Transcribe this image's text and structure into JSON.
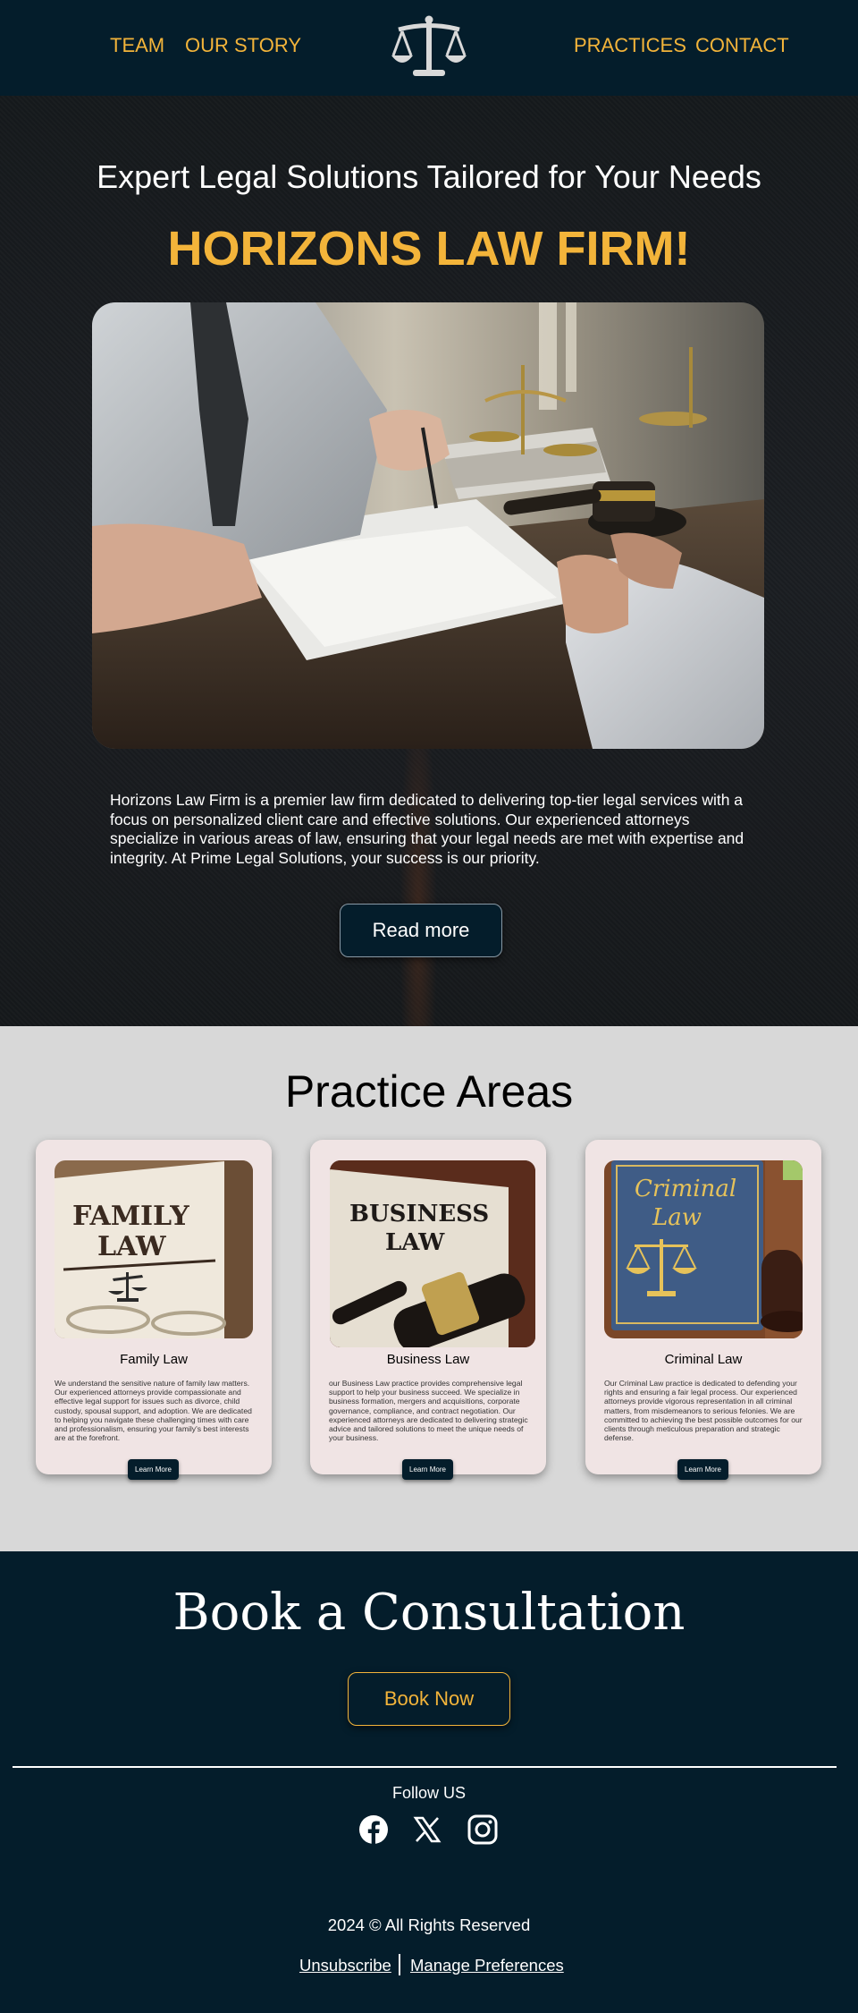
{
  "nav": {
    "left_links": [
      "TEAM",
      "OUR STORY"
    ],
    "right_links": [
      "PRACTICES",
      "CONTACT"
    ],
    "logo_icon": "scales-of-justice-icon",
    "accent": "#f3b43a"
  },
  "hero": {
    "kicker": "Expert Legal Solutions Tailored for Your Needs",
    "title": "HORIZONS LAW FIRM!",
    "image": "lawyer-meeting-photo",
    "description": "Horizons Law Firm is a premier law firm dedicated to delivering top-tier legal services with a focus on personalized client care and effective solutions. Our experienced attorneys specialize in various areas of law, ensuring that your legal needs are met with expertise and integrity. At Prime Legal Solutions, your success is our priority.",
    "read_more": "Read more"
  },
  "practice": {
    "title": "Practice Areas",
    "cards": [
      {
        "title": "Family Law",
        "book_text": "FAMILY LAW",
        "description": "We understand the sensitive nature of family law matters. Our experienced attorneys provide compassionate and effective legal support for issues such as divorce, child custody, spousal support, and adoption. We are dedicated to helping you navigate these challenging times with care and professionalism, ensuring your family's best interests are at the forefront.",
        "button": "Learn More"
      },
      {
        "title": "Business Law",
        "book_text": "BUSINESS LAW",
        "description": "our Business Law practice provides comprehensive legal support to help your business succeed. We specialize in business formation, mergers and acquisitions, corporate governance, compliance, and contract negotiation. Our experienced attorneys are dedicated to delivering strategic advice and tailored solutions to meet the unique needs of your business.",
        "button": "Learn More"
      },
      {
        "title": "Criminal Law",
        "book_text": "Criminal Law",
        "description": "Our Criminal Law practice is dedicated to defending your rights and ensuring a fair legal process. Our experienced attorneys provide vigorous representation in all criminal matters, from misdemeanors to serious felonies. We are committed to achieving the best possible outcomes for our clients through meticulous preparation and strategic defense.",
        "button": "Learn More"
      }
    ]
  },
  "consult": {
    "title": "Book a Consultation",
    "book_now": "Book Now",
    "follow": "Follow US",
    "social_icons": [
      "facebook-icon",
      "x-icon",
      "instagram-icon"
    ],
    "copyright": "2024 © All Rights Reserved",
    "unsubscribe": "Unsubscribe",
    "manage": "Manage Preferences"
  }
}
